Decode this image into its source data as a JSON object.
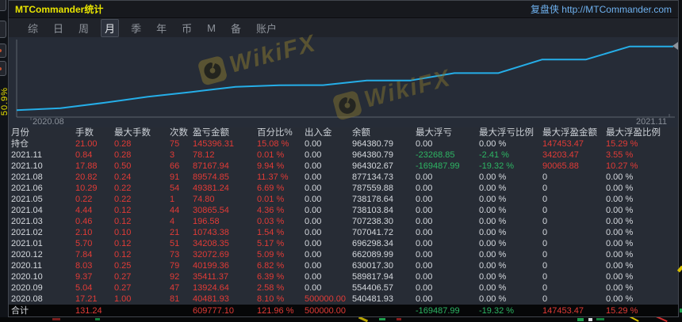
{
  "window": {
    "title": "MTCommander统计",
    "brand_link": "复盘侠 http://MTCommander.com"
  },
  "menu": {
    "items": [
      "综",
      "日",
      "周",
      "月",
      "季",
      "年",
      "币",
      "M",
      "备",
      "账户"
    ],
    "selected": "月"
  },
  "side_label": "50.9%",
  "watermark": {
    "text": "WikiFX"
  },
  "chart_data": {
    "type": "line",
    "title": "账户余额走势 (monthly equity curve)",
    "x": [
      "2020.08",
      "2020.09",
      "2020.10",
      "2020.11",
      "2020.12",
      "2021.01",
      "2021.02",
      "2021.03",
      "2021.04",
      "2021.05",
      "2021.06",
      "2021.07",
      "2021.08",
      "2021.09",
      "2021.10",
      "2021.11"
    ],
    "series": [
      {
        "name": "余额",
        "values": [
          540481.93,
          554406.57,
          589817.94,
          630017.3,
          662089.99,
          696298.34,
          707041.72,
          707238.3,
          738103.84,
          738178.64,
          787559.88,
          787559.88,
          877134.73,
          877134.73,
          964302.67,
          964380.79
        ]
      }
    ],
    "xlabel_left": "2020.08",
    "xlabel_right": "2021.11",
    "ylim": [
      500000,
      1000000
    ],
    "line_color": "#25aee8",
    "grid": false,
    "legend": "none"
  },
  "table": {
    "columns": [
      "月份",
      "手数",
      "最大手数",
      "次数",
      "盈亏金额",
      "百分比%",
      "出入金",
      "余额",
      "最大浮亏",
      "最大浮亏比例",
      "最大浮盈金额",
      "最大浮盈比例"
    ],
    "rows": [
      {
        "cells": [
          "持仓",
          "21.00",
          "0.28",
          "75",
          "145396.31",
          "15.08 %",
          "0.00",
          "964380.79",
          "0.00",
          "0.00 %",
          "147453.47",
          "15.29 %"
        ],
        "colors": "wrrrrrwwwwrr"
      },
      {
        "cells": [
          "2021.11",
          "0.84",
          "0.28",
          "3",
          "78.12",
          "0.01 %",
          "0.00",
          "964380.79",
          "-23268.85",
          "-2.41 %",
          "34203.47",
          "3.55 %"
        ],
        "colors": "wrrrrrwwggrr"
      },
      {
        "cells": [
          "2021.10",
          "17.88",
          "0.50",
          "66",
          "87167.94",
          "9.94 %",
          "0.00",
          "964302.67",
          "-169487.99",
          "-19.32 %",
          "90065.88",
          "10.27 %"
        ],
        "colors": "wrrrrrwwggrr"
      },
      {
        "cells": [
          "2021.08",
          "20.82",
          "0.24",
          "91",
          "89574.85",
          "11.37 %",
          "0.00",
          "877134.73",
          "0.00",
          "0.00 %",
          "0",
          "0.00 %"
        ],
        "colors": "wrrrrrwwwwww"
      },
      {
        "cells": [
          "2021.06",
          "10.29",
          "0.22",
          "54",
          "49381.24",
          "6.69 %",
          "0.00",
          "787559.88",
          "0.00",
          "0.00 %",
          "0",
          "0.00 %"
        ],
        "colors": "wrrrrrwwwwww"
      },
      {
        "cells": [
          "2021.05",
          "0.22",
          "0.22",
          "1",
          "74.80",
          "0.01 %",
          "0.00",
          "738178.64",
          "0.00",
          "0.00 %",
          "0",
          "0.00 %"
        ],
        "colors": "wrrrrrwwwwww"
      },
      {
        "cells": [
          "2021.04",
          "4.44",
          "0.12",
          "44",
          "30865.54",
          "4.36 %",
          "0.00",
          "738103.84",
          "0.00",
          "0.00 %",
          "0",
          "0.00 %"
        ],
        "colors": "wrrrrrwwwwww"
      },
      {
        "cells": [
          "2021.03",
          "0.46",
          "0.12",
          "4",
          "196.58",
          "0.03 %",
          "0.00",
          "707238.30",
          "0.00",
          "0.00 %",
          "0",
          "0.00 %"
        ],
        "colors": "wrrrrrwwwwww"
      },
      {
        "cells": [
          "2021.02",
          "2.10",
          "0.10",
          "21",
          "10743.38",
          "1.54 %",
          "0.00",
          "707041.72",
          "0.00",
          "0.00 %",
          "0",
          "0.00 %"
        ],
        "colors": "wrrrrrwwwwww"
      },
      {
        "cells": [
          "2021.01",
          "5.70",
          "0.12",
          "51",
          "34208.35",
          "5.17 %",
          "0.00",
          "696298.34",
          "0.00",
          "0.00 %",
          "0",
          "0.00 %"
        ],
        "colors": "wrrrrrwwwwww"
      },
      {
        "cells": [
          "2020.12",
          "7.84",
          "0.12",
          "73",
          "32072.69",
          "5.09 %",
          "0.00",
          "662089.99",
          "0.00",
          "0.00 %",
          "0",
          "0.00 %"
        ],
        "colors": "wrrrrrwwwwww"
      },
      {
        "cells": [
          "2020.11",
          "8.03",
          "0.25",
          "79",
          "40199.36",
          "6.82 %",
          "0.00",
          "630017.30",
          "0.00",
          "0.00 %",
          "0",
          "0.00 %"
        ],
        "colors": "wrrrrrwwwwww"
      },
      {
        "cells": [
          "2020.10",
          "9.37",
          "0.27",
          "92",
          "35411.37",
          "6.39 %",
          "0.00",
          "589817.94",
          "0.00",
          "0.00 %",
          "0",
          "0.00 %"
        ],
        "colors": "wrrrrrwwwwww"
      },
      {
        "cells": [
          "2020.09",
          "5.04",
          "0.27",
          "47",
          "13924.64",
          "2.58 %",
          "0.00",
          "554406.57",
          "0.00",
          "0.00 %",
          "0",
          "0.00 %"
        ],
        "colors": "wrrrrrwwwwww"
      },
      {
        "cells": [
          "2020.08",
          "17.21",
          "1.00",
          "81",
          "40481.93",
          "8.10 %",
          "500000.00",
          "540481.93",
          "0.00",
          "0.00 %",
          "0",
          "0.00 %"
        ],
        "colors": "wrrrrrrwwwww"
      },
      {
        "cells": [
          "合计",
          "131.24",
          "",
          "",
          "609777.10",
          "121.96 %",
          "500000.00",
          "",
          "-169487.99",
          "-19.32 %",
          "147453.47",
          "15.29 %"
        ],
        "colors": "wrwwrrrwggrr",
        "total": true
      }
    ]
  }
}
